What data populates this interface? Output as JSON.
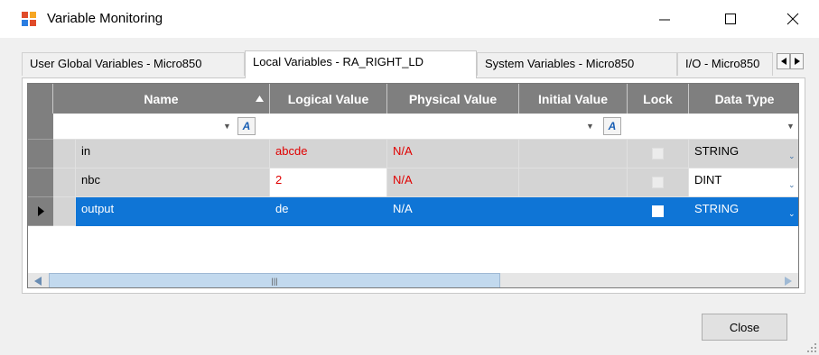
{
  "window": {
    "title": "Variable Monitoring"
  },
  "tabs": [
    {
      "label": "User Global Variables - Micro850"
    },
    {
      "label": "Local Variables - RA_RIGHT_LD"
    },
    {
      "label": "System Variables - Micro850"
    },
    {
      "label": "I/O - Micro850"
    }
  ],
  "active_tab": 1,
  "grid": {
    "columns": [
      "Name",
      "Logical Value",
      "Physical Value",
      "Initial Value",
      "Lock",
      "Data Type"
    ],
    "sort_column": "Name",
    "rows": [
      {
        "name": "in",
        "logical": "abcde",
        "physical": "N/A",
        "initial": "",
        "lock": false,
        "type": "STRING"
      },
      {
        "name": "nbc",
        "logical": "2",
        "physical": "N/A",
        "initial": "",
        "lock": false,
        "type": "DINT"
      },
      {
        "name": "output",
        "logical": "de",
        "physical": "N/A",
        "initial": "",
        "lock": false,
        "type": "STRING"
      }
    ],
    "selected_row": 2
  },
  "buttons": {
    "close": "Close"
  },
  "colors": {
    "selection": "#0f75d6",
    "header": "#7f7f7f",
    "error_text": "#e00000"
  }
}
